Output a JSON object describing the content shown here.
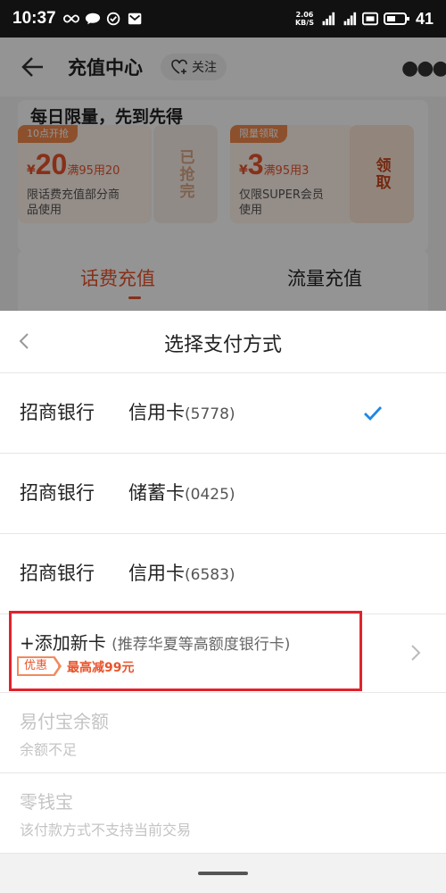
{
  "status_bar": {
    "time": "10:37",
    "speed_value": "2.06",
    "speed_unit": "KB/S",
    "battery": "41"
  },
  "header": {
    "title": "充值中心",
    "follow_label": "关注"
  },
  "promo": {
    "heading": "每日限量，先到先得",
    "coupons": [
      {
        "tag": "10点开抢",
        "currency": "¥",
        "amount": "20",
        "condition": "满95用20",
        "desc_line1": "限话费充值部分商",
        "desc_line2": "品使用",
        "side_label": "已抢完"
      },
      {
        "tag": "限量领取",
        "currency": "¥",
        "amount": "3",
        "condition": "满95用3",
        "desc_line1": "仅限SUPER会员",
        "desc_line2": "使用",
        "side_label": "领取"
      }
    ]
  },
  "tabs": [
    {
      "label": "话费充值",
      "active": true
    },
    {
      "label": "流量充值",
      "active": false
    }
  ],
  "sheet": {
    "title": "选择支付方式",
    "cards": [
      {
        "bank": "招商银行",
        "type": "信用卡",
        "number": "(5778)",
        "selected": true
      },
      {
        "bank": "招商银行",
        "type": "储蓄卡",
        "number": "(0425)",
        "selected": false
      },
      {
        "bank": "招商银行",
        "type": "信用卡",
        "number": "(6583)",
        "selected": false
      }
    ],
    "add_card": {
      "title": "+添加新卡",
      "hint": "(推荐华夏等高额度银行卡)",
      "badge": "优惠",
      "promo": "最高减99元"
    },
    "disabled": [
      {
        "title": "易付宝余额",
        "subtitle": "余额不足"
      },
      {
        "title": "零钱宝",
        "subtitle": "该付款方式不支持当前交易"
      }
    ]
  },
  "colors": {
    "accent": "#e8542b",
    "check": "#1e88e5",
    "highlight_box": "#e0232c"
  }
}
